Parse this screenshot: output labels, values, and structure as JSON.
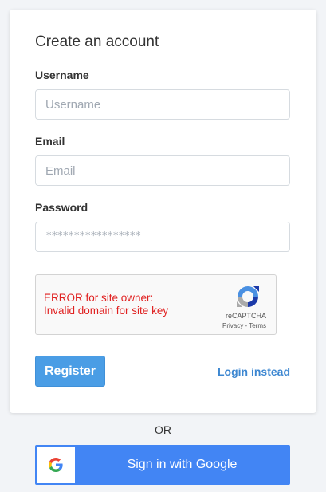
{
  "form": {
    "title": "Create an account",
    "username": {
      "label": "Username",
      "placeholder": "Username",
      "value": ""
    },
    "email": {
      "label": "Email",
      "placeholder": "Email",
      "value": ""
    },
    "password": {
      "label": "Password",
      "masked": "*****************"
    }
  },
  "captcha": {
    "error_line1": "ERROR for site owner:",
    "error_line2": "Invalid domain for site key",
    "brand": "reCAPTCHA",
    "links": "Privacy - Terms"
  },
  "actions": {
    "register_label": "Register",
    "login_label": "Login instead"
  },
  "divider": {
    "or_label": "OR"
  },
  "google": {
    "label": "Sign in with Google",
    "icon": "google-g-icon",
    "color": "#4285f4"
  },
  "colors": {
    "primary": "#4a9de5",
    "link": "#3d87d1",
    "error": "#e02020"
  }
}
